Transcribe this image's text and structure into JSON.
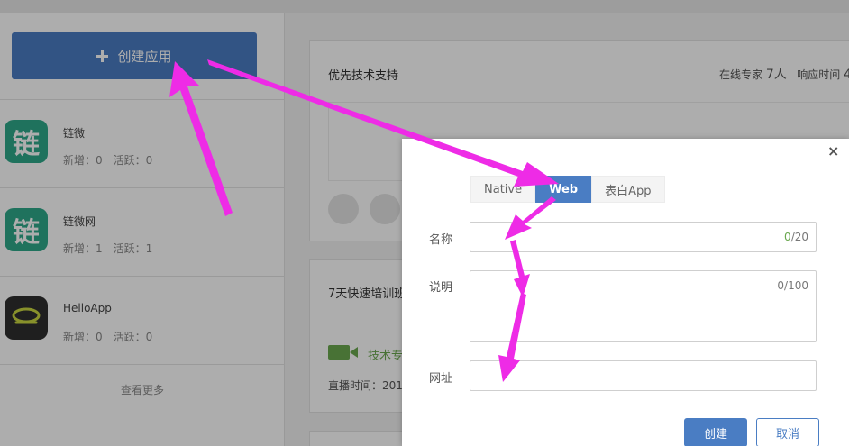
{
  "sidebar": {
    "create_button_label": "创建应用",
    "apps": [
      {
        "name": "链微",
        "icon_glyph": "链",
        "stats": {
          "new": "新增：0",
          "active": "活跃：0"
        }
      },
      {
        "name": "链微网",
        "icon_glyph": "链",
        "stats": {
          "new": "新增：1",
          "active": "活跃：1"
        }
      },
      {
        "name": "HelloApp",
        "icon_glyph": "",
        "stats": {
          "new": "新增：0",
          "active": "活跃：0"
        }
      }
    ],
    "more_label": "查看更多"
  },
  "support_card": {
    "title": "优先技术支持",
    "experts_prefix": "在线专家",
    "experts_count": "7人",
    "response_prefix": "响应时间",
    "response_value": "4"
  },
  "training_card": {
    "title": "7天快速培训班",
    "tech_text": "技术专",
    "live_time": "直播时间：201"
  },
  "modal": {
    "tabs": [
      {
        "label": "Native",
        "active": false
      },
      {
        "label": "Web",
        "active": true
      },
      {
        "label": "表白App",
        "active": false
      }
    ],
    "name_label": "名称",
    "name_count": "0",
    "name_max": "/20",
    "desc_label": "说明",
    "desc_count": "0",
    "desc_max": "/100",
    "url_label": "网址",
    "create_label": "创建",
    "cancel_label": "取消",
    "close_glyph": "×"
  },
  "colors": {
    "primary": "#4a7dc3",
    "app_green": "#2fa88a",
    "accent_green": "#6aa84f",
    "annotation_magenta": "#ee2be6"
  }
}
